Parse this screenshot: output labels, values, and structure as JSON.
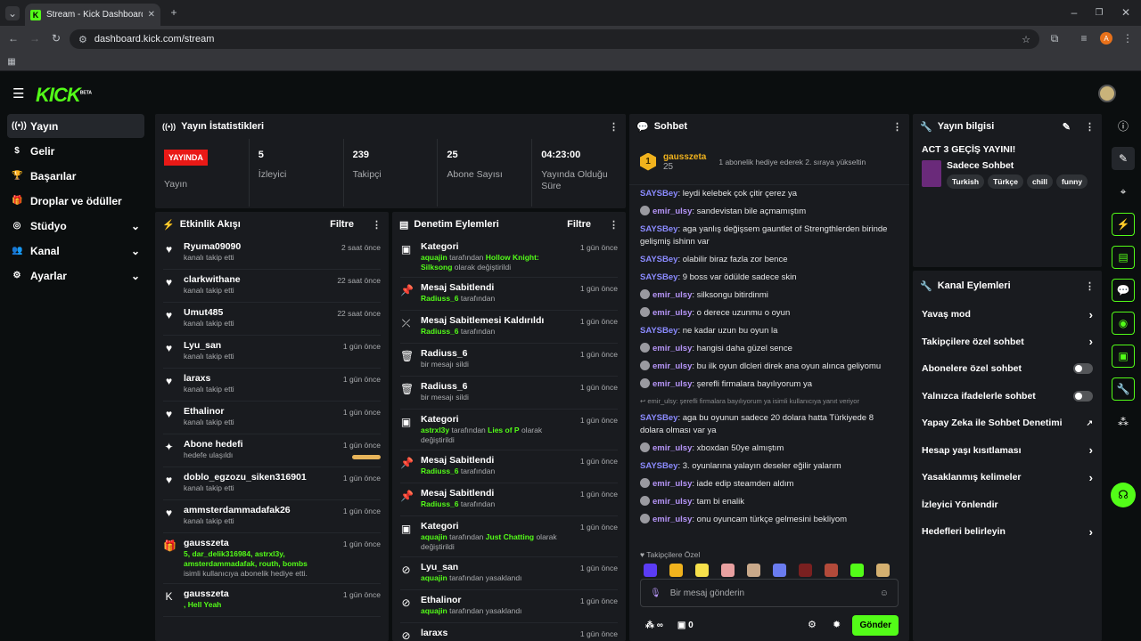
{
  "browser": {
    "tab_title": "Stream - Kick Dashboard",
    "url": "dashboard.kick.com/stream",
    "profile_initial": "A"
  },
  "logo": {
    "text": "KICK",
    "beta": "BETA"
  },
  "sidebar": {
    "items": [
      {
        "label": "Yayın",
        "icon": "broadcast-icon",
        "active": true
      },
      {
        "label": "Gelir",
        "icon": "dollar-icon"
      },
      {
        "label": "Başarılar",
        "icon": "trophy-icon"
      },
      {
        "label": "Droplar ve ödüller",
        "icon": "gift-icon"
      },
      {
        "label": "Stüdyo",
        "icon": "studio-icon",
        "expand": true
      },
      {
        "label": "Kanal",
        "icon": "users-icon",
        "expand": true
      },
      {
        "label": "Ayarlar",
        "icon": "gear-icon",
        "expand": true
      }
    ]
  },
  "stats": {
    "title": "Yayın İstatistikleri",
    "live_label": "YAYINDA",
    "cells": [
      {
        "value": "",
        "label": "Yayın"
      },
      {
        "value": "5",
        "label": "İzleyici"
      },
      {
        "value": "239",
        "label": "Takipçi"
      },
      {
        "value": "25",
        "label": "Abone Sayısı"
      },
      {
        "value": "04:23:00",
        "label": "Yayında Olduğu Süre"
      }
    ]
  },
  "activity": {
    "title": "Etkinlik Akışı",
    "filter": "Filtre",
    "rows": [
      {
        "name": "Ryuma09090",
        "sub": "kanalı takip etti",
        "time": "2 saat önce",
        "icon": "heart-icon"
      },
      {
        "name": "clarkwithane",
        "sub": "kanalı takip etti",
        "time": "22 saat önce",
        "icon": "heart-icon"
      },
      {
        "name": "Umut485",
        "sub": "kanalı takip etti",
        "time": "22 saat önce",
        "icon": "heart-icon"
      },
      {
        "name": "Lyu_san",
        "sub": "kanalı takip etti",
        "time": "1 gün önce",
        "icon": "heart-icon"
      },
      {
        "name": "laraxs",
        "sub": "kanalı takip etti",
        "time": "1 gün önce",
        "icon": "heart-icon"
      },
      {
        "name": "Ethalinor",
        "sub": "kanalı takip etti",
        "time": "1 gün önce",
        "icon": "heart-icon"
      },
      {
        "name": "Abone hedefi",
        "sub": "hedefe ulaşıldı",
        "time": "1 gün önce",
        "icon": "sparkle-icon",
        "progress": 1.0
      },
      {
        "name": "doblo_egzozu_siken316901",
        "sub": "kanalı takip etti",
        "time": "1 gün önce",
        "icon": "heart-icon"
      },
      {
        "name": "ammsterdammadafak26",
        "sub": "kanalı takip etti",
        "time": "1 gün önce",
        "icon": "heart-icon"
      },
      {
        "name": "gausszeta",
        "green": "5, dar_delik316984, astrxl3y, amsterdammadafak, routh, bombs",
        "sub": "isimli kullanıcıya abonelik hediye etti.",
        "time": "1 gün önce",
        "icon": "gift-sub-icon"
      },
      {
        "name": "gausszeta",
        "green": ", Hell Yeah",
        "sub": "",
        "time": "1 gün önce",
        "icon": "kick-icon"
      }
    ]
  },
  "moderation": {
    "title": "Denetim Eylemleri",
    "filter": "Filtre",
    "rows": [
      {
        "name": "Kategori",
        "g1": "aquajin",
        "m": " tarafından ",
        "g2": "Hollow Knight: Silksong",
        "e": " olarak değiştirildi",
        "time": "1 gün önce",
        "icon": "category-icon"
      },
      {
        "name": "Mesaj Sabitlendi",
        "g1": "Radiuss_6",
        "m": " tarafından",
        "time": "1 gün önce",
        "icon": "pin-icon"
      },
      {
        "name": "Mesaj Sabitlemesi Kaldırıldı",
        "g1": "Radiuss_6",
        "m": " tarafından",
        "time": "1 gün önce",
        "icon": "unpin-icon"
      },
      {
        "name": "Radiuss_6",
        "m": "bir mesajı sildi",
        "time": "1 gün önce",
        "icon": "trash-icon"
      },
      {
        "name": "Radiuss_6",
        "m": "bir mesajı sildi",
        "time": "1 gün önce",
        "icon": "trash-icon"
      },
      {
        "name": "Kategori",
        "g1": "astrxl3y",
        "m": " tarafından ",
        "g2": "Lies of P",
        "e": " olarak değiştirildi",
        "time": "1 gün önce",
        "icon": "category-icon"
      },
      {
        "name": "Mesaj Sabitlendi",
        "g1": "Radiuss_6",
        "m": " tarafından",
        "time": "1 gün önce",
        "icon": "pin-icon"
      },
      {
        "name": "Mesaj Sabitlendi",
        "g1": "Radiuss_6",
        "m": " tarafından",
        "time": "1 gün önce",
        "icon": "pin-icon"
      },
      {
        "name": "Kategori",
        "g1": "aquajin",
        "m": " tarafından ",
        "g2": "Just Chatting",
        "e": " olarak değiştirildi",
        "time": "1 gün önce",
        "icon": "category-icon"
      },
      {
        "name": "Lyu_san",
        "g1": "aquajin",
        "m": " tarafından yasaklandı",
        "time": "1 gün önce",
        "icon": "ban-icon"
      },
      {
        "name": "Ethalinor",
        "g1": "aquajin",
        "m": " tarafından yasaklandı",
        "time": "1 gün önce",
        "icon": "ban-icon"
      },
      {
        "name": "laraxs",
        "g1": "",
        "m": "",
        "time": "1 gün önce",
        "icon": "ban-icon"
      }
    ]
  },
  "chat": {
    "title": "Sohbet",
    "pinned": {
      "user": "gausszeta",
      "count": "25",
      "rank": "1",
      "text": "1 abonelik hediye ederek 2. sıraya yükseltin"
    },
    "messages": [
      {
        "user": "SAYSBey",
        "text": "leydi kelebek çok çitir çerez ya",
        "style": "u1"
      },
      {
        "user": "emir_ulsy",
        "text": "sandevistan bile açmamıştım",
        "style": "u2",
        "avatar": true
      },
      {
        "user": "SAYSBey",
        "text": "aga yanlış değişsem gauntlet of Strengthlerden birinde gelişmiş ishinn var",
        "style": "u1"
      },
      {
        "user": "SAYSBey",
        "text": "olabilir biraz fazla zor bence",
        "style": "u1"
      },
      {
        "user": "SAYSBey",
        "text": "9 boss var ödülde sadece skin",
        "style": "u1"
      },
      {
        "user": "emir_ulsy",
        "text": "silksongu bitirdinmi",
        "style": "u2",
        "avatar": true
      },
      {
        "user": "emir_ulsy",
        "text": "o derece uzunmu o oyun",
        "style": "u2",
        "avatar": true
      },
      {
        "user": "SAYSBey",
        "text": "ne kadar uzun bu oyun la",
        "style": "u1"
      },
      {
        "user": "emir_ulsy",
        "text": "hangisi daha güzel sence",
        "style": "u2",
        "avatar": true
      },
      {
        "user": "emir_ulsy",
        "text": "bu ilk oyun dlcleri direk ana oyun alınca geliyomu",
        "style": "u2",
        "avatar": true
      },
      {
        "user": "emir_ulsy",
        "text": "şerefli firmalara bayılıyorum ya",
        "style": "u2",
        "avatar": true
      }
    ],
    "reply": "emir_ulsy: şerefli firmalara bayılıyorum ya isimli kullanıcıya yanıt veriyor",
    "messages2": [
      {
        "user": "SAYSBey",
        "text": "aga bu oyunun sadece 20 dolara hatta Türkiyede 8 dolara olması var ya",
        "style": "u1"
      },
      {
        "user": "emir_ulsy",
        "text": "xboxdan 50ye almıştım",
        "style": "u2",
        "avatar": true
      },
      {
        "user": "SAYSBey",
        "text": "3. oyunlarına yalayın deseler eğilir yalarım",
        "style": "u1"
      },
      {
        "user": "emir_ulsy",
        "text": "iade edip steamden aldım",
        "style": "u2",
        "avatar": true
      },
      {
        "user": "emir_ulsy",
        "text": "tam bi enalik",
        "style": "u2",
        "avatar": true
      },
      {
        "user": "emir_ulsy",
        "text": "onu oyuncam türkçe gelmesini bekliyom",
        "style": "u2",
        "avatar": true
      }
    ],
    "emote_label": "Takipçilere Özel",
    "emote_colors": [
      "#5b3cf5",
      "#f0b21d",
      "#f6e04b",
      "#e8a0a0",
      "#c9a98a",
      "#6a7cf0",
      "#7a2020",
      "#b34a3a",
      "#53fc18",
      "#d4b070"
    ],
    "input_placeholder": "Bir mesaj gönderin",
    "counter": "0",
    "send_label": "Gönder"
  },
  "stream_info": {
    "title": "Yayın bilgisi",
    "stream_title": "ACT 3 GEÇİŞ YAYINI!",
    "category": "Sadece Sohbet",
    "tags": [
      "Turkish",
      "Türkçe",
      "chill",
      "funny"
    ]
  },
  "channel_actions": {
    "title": "Kanal Eylemleri",
    "rows": [
      {
        "label": "Yavaş mod",
        "ctrl": "chevron"
      },
      {
        "label": "Takipçilere özel sohbet",
        "ctrl": "chevron"
      },
      {
        "label": "Abonelere özel sohbet",
        "ctrl": "toggle"
      },
      {
        "label": "Yalnızca ifadelerle sohbet",
        "ctrl": "toggle"
      },
      {
        "label": "Yapay Zeka ile Sohbet Denetimi",
        "ctrl": "external"
      },
      {
        "label": "Hesap yaşı kısıtlaması",
        "ctrl": "chevron"
      },
      {
        "label": "Yasaklanmış kelimeler",
        "ctrl": "chevron"
      },
      {
        "label": "İzleyici Yönlendir",
        "ctrl": "none"
      },
      {
        "label": "Hedefleri belirleyin",
        "ctrl": "chevron"
      }
    ]
  },
  "colors": {
    "accent": "#53fc18",
    "live": "#e91916",
    "panel": "#191b1f"
  }
}
